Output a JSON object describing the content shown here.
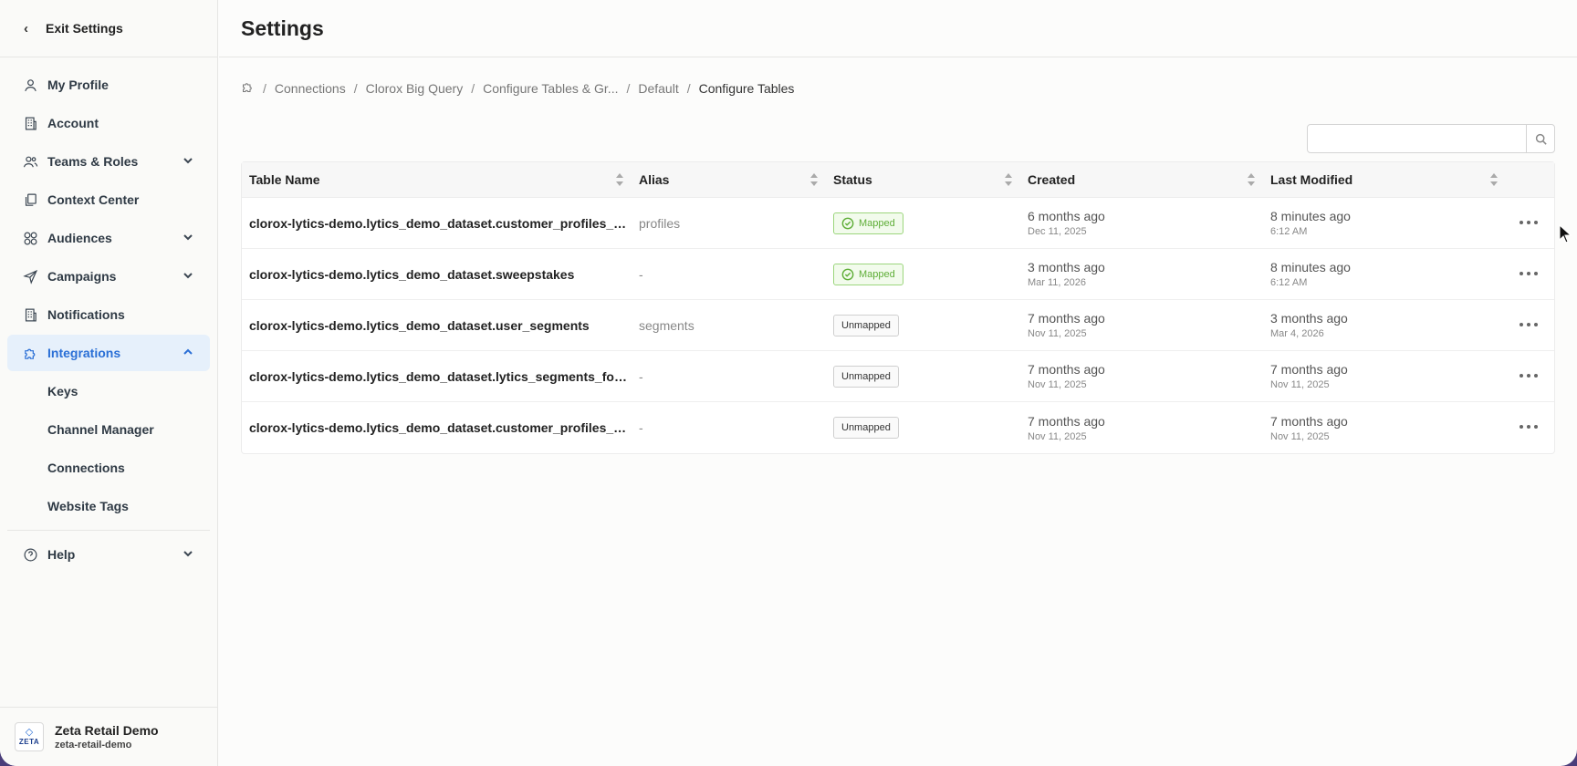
{
  "sidebar": {
    "exit_label": "Exit Settings",
    "items": [
      {
        "label": "My Profile",
        "icon": "user-icon"
      },
      {
        "label": "Account",
        "icon": "building-icon"
      },
      {
        "label": "Teams & Roles",
        "icon": "users-icon",
        "expandable": true
      },
      {
        "label": "Context Center",
        "icon": "copy-icon"
      },
      {
        "label": "Audiences",
        "icon": "audience-icon",
        "expandable": true
      },
      {
        "label": "Campaigns",
        "icon": "send-icon",
        "expandable": true
      },
      {
        "label": "Notifications",
        "icon": "building-icon"
      },
      {
        "label": "Integrations",
        "icon": "puzzle-icon",
        "expanded": true,
        "active": true
      }
    ],
    "sub_items": [
      "Keys",
      "Channel Manager",
      "Connections",
      "Website Tags"
    ],
    "help_label": "Help",
    "org": {
      "name": "Zeta Retail Demo",
      "slug": "zeta-retail-demo",
      "logo_text": "ZETA"
    }
  },
  "header": {
    "title": "Settings"
  },
  "breadcrumb": [
    "Connections",
    "Clorox Big Query",
    "Configure Tables & Gr...",
    "Default",
    "Configure Tables"
  ],
  "search": {
    "placeholder": "",
    "value": ""
  },
  "table": {
    "columns": [
      "Table Name",
      "Alias",
      "Status",
      "Created",
      "Last Modified"
    ],
    "rows": [
      {
        "name": "clorox-lytics-demo.lytics_demo_dataset.customer_profiles_stagi...",
        "alias": "profiles",
        "status": "Mapped",
        "created": "6 months ago",
        "created_date": "Dec 11, 2025",
        "modified": "8 minutes ago",
        "modified_date": "6:12 AM"
      },
      {
        "name": "clorox-lytics-demo.lytics_demo_dataset.sweepstakes",
        "alias": "-",
        "status": "Mapped",
        "created": "3 months ago",
        "created_date": "Mar 11, 2026",
        "modified": "8 minutes ago",
        "modified_date": "6:12 AM"
      },
      {
        "name": "clorox-lytics-demo.lytics_demo_dataset.user_segments",
        "alias": "segments",
        "status": "Unmapped",
        "created": "7 months ago",
        "created_date": "Nov 11, 2025",
        "modified": "3 months ago",
        "modified_date": "Mar 4, 2026"
      },
      {
        "name": "clorox-lytics-demo.lytics_demo_dataset.lytics_segments_for_zeta",
        "alias": "-",
        "status": "Unmapped",
        "created": "7 months ago",
        "created_date": "Nov 11, 2025",
        "modified": "7 months ago",
        "modified_date": "Nov 11, 2025"
      },
      {
        "name": "clorox-lytics-demo.lytics_demo_dataset.customer_profiles_clorox",
        "alias": "-",
        "status": "Unmapped",
        "created": "7 months ago",
        "created_date": "Nov 11, 2025",
        "modified": "7 months ago",
        "modified_date": "Nov 11, 2025"
      }
    ]
  },
  "colors": {
    "accent": "#2a6fd6",
    "active_bg": "#e6f0fb",
    "mapped_green": "#5fae38"
  }
}
